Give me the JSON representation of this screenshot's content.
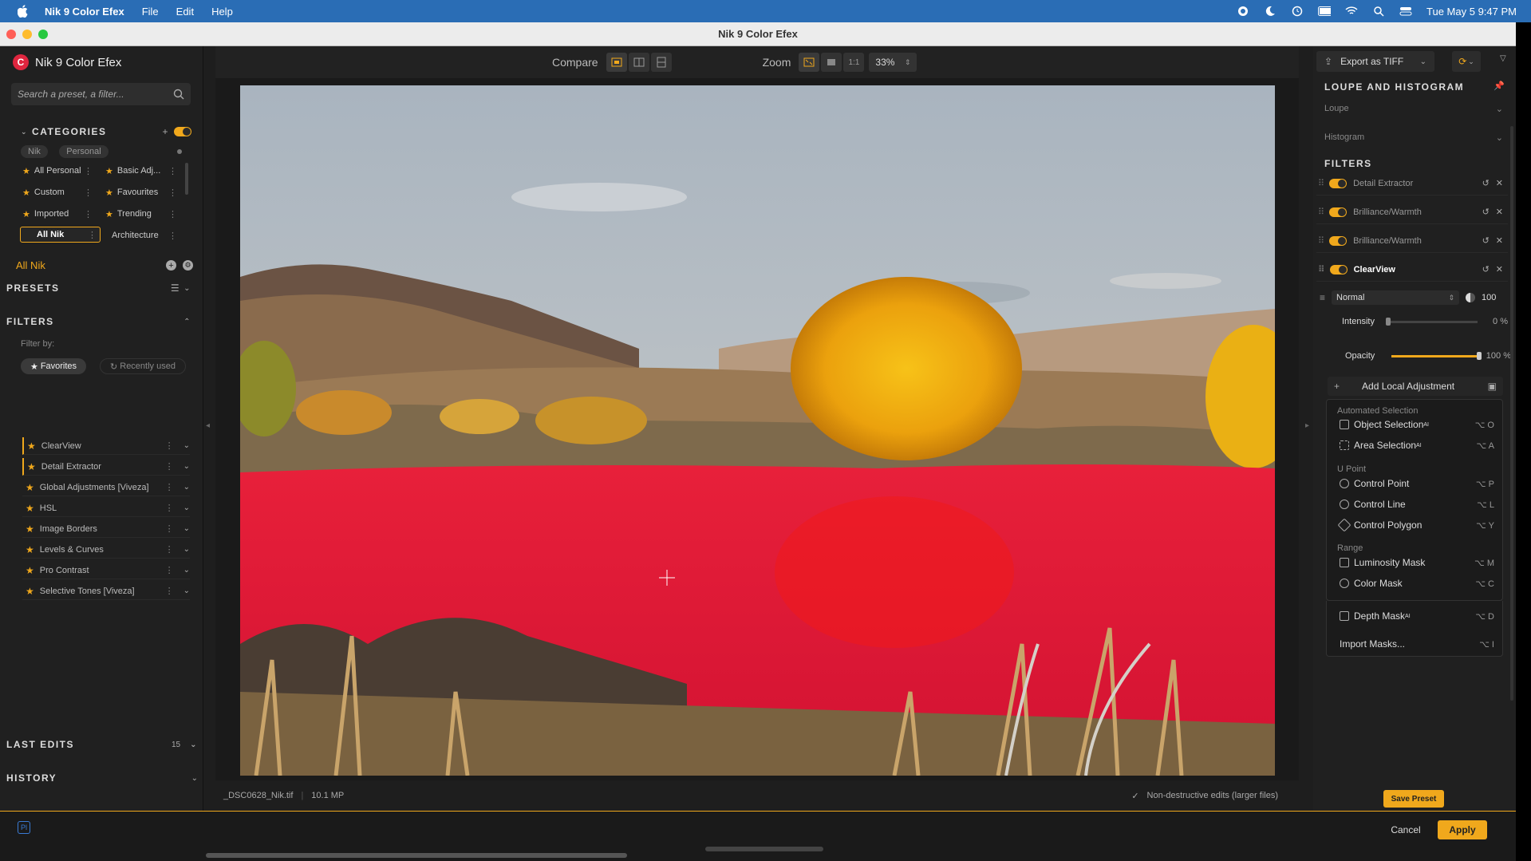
{
  "menubar": {
    "app_name": "Nik 9 Color Efex",
    "menus": [
      "File",
      "Edit",
      "Help"
    ],
    "clock": "Tue May 5  9:47 PM"
  },
  "window": {
    "title": "Nik 9 Color Efex"
  },
  "left": {
    "brand": "Nik 9 Color Efex",
    "search_placeholder": "Search a preset, a filter...",
    "categories_label": "CATEGORIES",
    "tags": [
      "Nik",
      "Personal"
    ],
    "categories": [
      {
        "label": "All Personal"
      },
      {
        "label": "Basic Adj..."
      },
      {
        "label": "Custom"
      },
      {
        "label": "Favourites"
      },
      {
        "label": "Imported"
      },
      {
        "label": "Trending"
      },
      {
        "label": "All Nik"
      },
      {
        "label": "Architecture"
      }
    ],
    "current_category": "All Nik",
    "presets_label": "PRESETS",
    "filters_label": "FILTERS",
    "filter_by": "Filter by:",
    "favorites_btn": "Favorites",
    "recent_btn": "Recently used",
    "filters": [
      "ClearView",
      "Detail Extractor",
      "Global Adjustments [Viveza]",
      "HSL",
      "Image Borders",
      "Levels & Curves",
      "Pro Contrast",
      "Selective Tones [Viveza]"
    ],
    "last_edits_label": "LAST EDITS",
    "last_edits_count": "15",
    "history_label": "HISTORY"
  },
  "center": {
    "compare_label": "Compare",
    "zoom_label": "Zoom",
    "zoom_1to1": "1:1",
    "zoom_value": "33%",
    "filename": "_DSC0628_Nik.tif",
    "megapixels": "10.1 MP",
    "nondestructive": "Non-destructive edits (larger files)"
  },
  "right": {
    "export_label": "Export as TIFF",
    "loupe_section": "LOUPE AND HISTOGRAM",
    "loupe": "Loupe",
    "histogram": "Histogram",
    "filters_section": "FILTERS",
    "filter_stack": [
      "Detail Extractor",
      "Brilliance/Warmth",
      "Brilliance/Warmth",
      "ClearView"
    ],
    "blend_mode": "Normal",
    "blend_value": "100",
    "intensity_label": "Intensity",
    "intensity_value": "0 %",
    "opacity_label": "Opacity",
    "opacity_value": "100 %",
    "add_local": "Add Local Adjustment",
    "save_preset": "Save Preset",
    "cancel": "Cancel",
    "apply": "Apply"
  },
  "menu": {
    "group_auto": "Automated Selection",
    "object_sel": "Object Selection",
    "object_sc": "⌥ O",
    "area_sel": "Area Selection",
    "area_sc": "⌥ A",
    "ai_sup": "AI",
    "group_upoint": "U Point",
    "control_point": "Control Point",
    "control_point_sc": "⌥ P",
    "control_line": "Control Line",
    "control_line_sc": "⌥ L",
    "control_polygon": "Control Polygon",
    "control_polygon_sc": "⌥ Y",
    "group_range": "Range",
    "lum_mask": "Luminosity Mask",
    "lum_mask_sc": "⌥ M",
    "color_mask": "Color Mask",
    "color_mask_sc": "⌥ C",
    "depth_mask": "Depth Mask",
    "depth_mask_sc": "⌥ D",
    "import_masks": "Import Masks...",
    "import_masks_sc": "⌥ I"
  },
  "colors": {
    "accent": "#f0a81c",
    "mask": "#e8102c"
  }
}
